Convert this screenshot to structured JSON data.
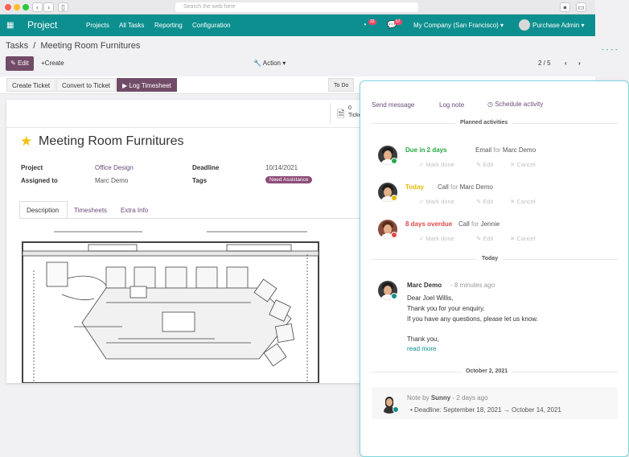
{
  "browser": {
    "url_placeholder": "Search the web here"
  },
  "topbar": {
    "app_name": "Project",
    "menu": [
      "Projects",
      "All Tasks",
      "Reporting",
      "Configuration"
    ],
    "activity_count": "32",
    "message_count": "57",
    "company": "My Company (San Francisco)",
    "user": "Purchase Admin"
  },
  "breadcrumb": {
    "parent": "Tasks",
    "separator": "/",
    "current": "Meeting Room Furnitures"
  },
  "control": {
    "edit_label": "Edit",
    "create_label": "Create",
    "action_label": "Action",
    "pager": "2 / 5"
  },
  "statusbar": {
    "create_ticket": "Create Ticket",
    "convert_ticket": "Convert to Ticket",
    "log_timesheet": "Log Timesheet",
    "stage": "To Do"
  },
  "smart_button": {
    "count": "0",
    "label": "Tickets"
  },
  "task": {
    "title": "Meeting Room Furnitures",
    "fields": {
      "project_label": "Project",
      "project_value": "Office Design",
      "assigned_label": "Assigned to",
      "assigned_value": "Marc Demo",
      "deadline_label": "Deadline",
      "deadline_value": "10/14/2021",
      "tags_label": "Tags",
      "tag_value": "Need Assistance"
    },
    "tabs": [
      "Description",
      "Timesheets",
      "Extra Info"
    ]
  },
  "chatter": {
    "send_message": "Send message",
    "log_note": "Log note",
    "schedule_activity": "Schedule activity",
    "planned_header": "Planned activities",
    "activity_actions": {
      "done": "Mark done",
      "edit": "Edit",
      "cancel": "Cancel"
    },
    "activities": [
      {
        "status": "Due in 2 days",
        "type": "Email",
        "for_word": "for",
        "person": "Marc Demo",
        "color": "#28a745"
      },
      {
        "status": "Today",
        "type": "Call",
        "for_word": "for",
        "person": "Marc Demo",
        "color": "#e6b800"
      },
      {
        "status": "8 days overdue",
        "type": "Call",
        "for_word": "for",
        "person": "Jennie",
        "color": "#e04848"
      }
    ],
    "today_label": "Today",
    "message": {
      "author": "Marc Demo",
      "time": "- 8 minutes ago",
      "lines": [
        "Dear Joel Willis,",
        "Thank you for your enquiry.",
        "If you have any questions, please let us know."
      ],
      "closing": "Thank you,",
      "read_more": "read more"
    },
    "date_label": "October 2, 2021",
    "note": {
      "prefix": "Note by",
      "author": "Sunny",
      "time": "- 2 days ago",
      "change": "Deadline: September 18, 2021",
      "arrow": "→",
      "new_value": "October 14, 2021"
    }
  },
  "colors": {
    "brand": "#0d8f8f",
    "primary": "#714b67",
    "accent_link": "#6b4b78"
  }
}
